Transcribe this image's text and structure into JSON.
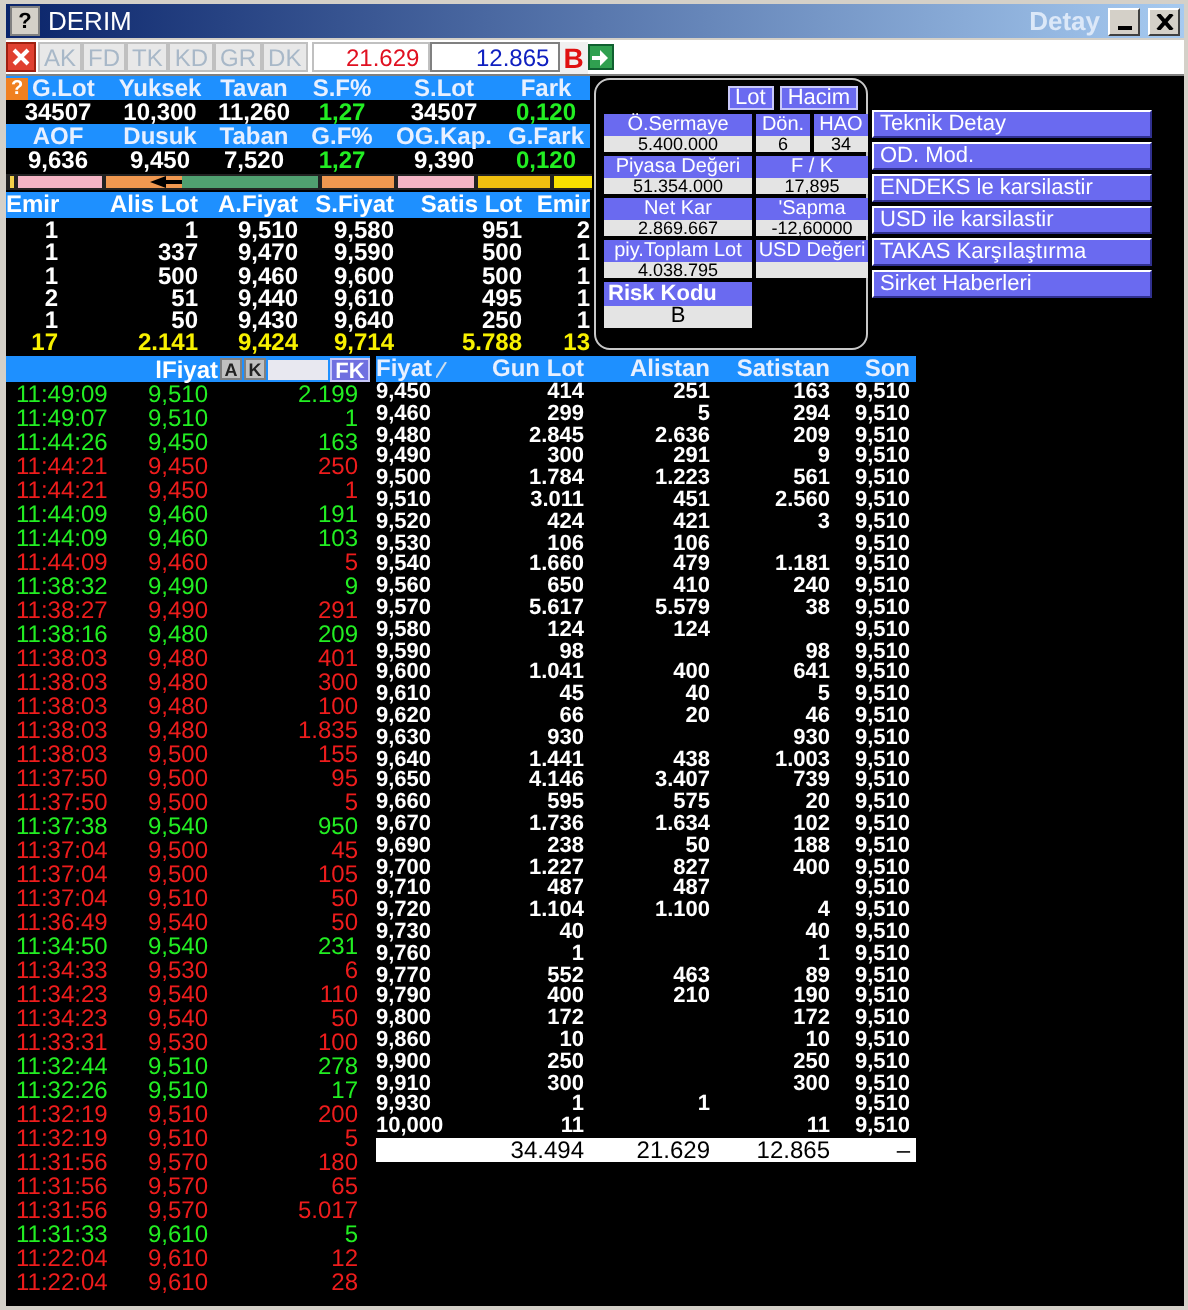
{
  "window": {
    "help": "?",
    "title": "DERIM",
    "subtitle": "Detay"
  },
  "summary_help": "?",
  "toolbar": {
    "tabs": [
      {
        "label": "AK",
        "disabled": true
      },
      {
        "label": "FD",
        "disabled": true
      },
      {
        "label": "TK",
        "disabled": true
      },
      {
        "label": "KD",
        "disabled": true
      },
      {
        "label": "GR",
        "disabled": true
      },
      {
        "label": "DK",
        "disabled": true
      }
    ],
    "bid_total": "21.629",
    "ask_total": "12.865",
    "mode": "B"
  },
  "summary": [
    {
      "headers": [
        "G.Lot",
        "Yuksek",
        "Tavan",
        "S.F%",
        "S.Lot",
        "Fark"
      ],
      "values": [
        "34507",
        "10,300",
        "11,260",
        "1,27",
        "34507",
        "0,120"
      ]
    },
    {
      "headers": [
        "AOF",
        "Dusuk",
        "Taban",
        "G.F%",
        "OG.Kap.",
        "G.Fark"
      ],
      "values": [
        "9,636",
        "9,450",
        "7,520",
        "1,27",
        "9,390",
        "0,120"
      ]
    }
  ],
  "depth": {
    "columns": [
      "Emir",
      "Alis Lot",
      "A.Fiyat",
      "S.Fiyat",
      "Satis Lot",
      "Emir"
    ],
    "rows": [
      [
        "1",
        "1",
        "9,510",
        "9,580",
        "951",
        "2"
      ],
      [
        "1",
        "337",
        "9,470",
        "9,590",
        "500",
        "1"
      ],
      [
        "1",
        "500",
        "9,460",
        "9,600",
        "500",
        "1"
      ],
      [
        "2",
        "51",
        "9,440",
        "9,610",
        "495",
        "1"
      ],
      [
        "1",
        "50",
        "9,430",
        "9,640",
        "250",
        "1"
      ]
    ],
    "totals": [
      "17",
      "2.141",
      "9,424",
      "9,714",
      "5.788",
      "13"
    ]
  },
  "info_panel": {
    "toggles": [
      "Lot",
      "Hacim"
    ],
    "fields": [
      {
        "label": "Ö.Sermaye",
        "value": "5.400.000"
      },
      {
        "label": "Dön.",
        "value": "6"
      },
      {
        "label": "HAO",
        "value": "34"
      },
      {
        "label": "Piyasa Değeri",
        "value": "51.354.000"
      },
      {
        "label": "F / K",
        "value": "17,895"
      },
      {
        "label": "Net Kar",
        "value": "2.869.667"
      },
      {
        "label": "'Sapma",
        "value": "-12,60000"
      },
      {
        "label": "piy.Toplam Lot",
        "value": "4.038.795"
      },
      {
        "label": "USD Değeri"
      }
    ],
    "risk": {
      "label": "Risk Kodu",
      "value": "B"
    }
  },
  "actions": [
    "Teknik Detay",
    "OD. Mod.",
    "ENDEKS le karsilastir",
    "USD ile karsilastir",
    "TAKAS Karşılaştırma",
    "Sirket Haberleri"
  ],
  "trades": {
    "price_label": "lFiyat",
    "buttons": [
      "A",
      "K"
    ],
    "filter_button": "FK",
    "rows": [
      {
        "time": "11:49:09",
        "price": "9,510",
        "lot": "2.199",
        "kind": "buy"
      },
      {
        "time": "11:49:07",
        "price": "9,510",
        "lot": "1",
        "kind": "buy"
      },
      {
        "time": "11:44:26",
        "price": "9,450",
        "lot": "163",
        "kind": "buy"
      },
      {
        "time": "11:44:21",
        "price": "9,450",
        "lot": "250",
        "kind": "sell"
      },
      {
        "time": "11:44:21",
        "price": "9,450",
        "lot": "1",
        "kind": "sell"
      },
      {
        "time": "11:44:09",
        "price": "9,460",
        "lot": "191",
        "kind": "buy"
      },
      {
        "time": "11:44:09",
        "price": "9,460",
        "lot": "103",
        "kind": "buy"
      },
      {
        "time": "11:44:09",
        "price": "9,460",
        "lot": "5",
        "kind": "sell"
      },
      {
        "time": "11:38:32",
        "price": "9,490",
        "lot": "9",
        "kind": "buy"
      },
      {
        "time": "11:38:27",
        "price": "9,490",
        "lot": "291",
        "kind": "sell"
      },
      {
        "time": "11:38:16",
        "price": "9,480",
        "lot": "209",
        "kind": "buy"
      },
      {
        "time": "11:38:03",
        "price": "9,480",
        "lot": "401",
        "kind": "sell"
      },
      {
        "time": "11:38:03",
        "price": "9,480",
        "lot": "300",
        "kind": "sell"
      },
      {
        "time": "11:38:03",
        "price": "9,480",
        "lot": "100",
        "kind": "sell"
      },
      {
        "time": "11:38:03",
        "price": "9,480",
        "lot": "1.835",
        "kind": "sell"
      },
      {
        "time": "11:38:03",
        "price": "9,500",
        "lot": "155",
        "kind": "sell"
      },
      {
        "time": "11:37:50",
        "price": "9,500",
        "lot": "95",
        "kind": "sell"
      },
      {
        "time": "11:37:50",
        "price": "9,500",
        "lot": "5",
        "kind": "sell"
      },
      {
        "time": "11:37:38",
        "price": "9,540",
        "lot": "950",
        "kind": "buy"
      },
      {
        "time": "11:37:04",
        "price": "9,500",
        "lot": "45",
        "kind": "sell"
      },
      {
        "time": "11:37:04",
        "price": "9,500",
        "lot": "105",
        "kind": "sell"
      },
      {
        "time": "11:37:04",
        "price": "9,510",
        "lot": "50",
        "kind": "sell"
      },
      {
        "time": "11:36:49",
        "price": "9,540",
        "lot": "50",
        "kind": "sell"
      },
      {
        "time": "11:34:50",
        "price": "9,540",
        "lot": "231",
        "kind": "buy"
      },
      {
        "time": "11:34:33",
        "price": "9,530",
        "lot": "6",
        "kind": "sell"
      },
      {
        "time": "11:34:23",
        "price": "9,540",
        "lot": "110",
        "kind": "sell"
      },
      {
        "time": "11:34:23",
        "price": "9,540",
        "lot": "50",
        "kind": "sell"
      },
      {
        "time": "11:33:31",
        "price": "9,530",
        "lot": "100",
        "kind": "sell"
      },
      {
        "time": "11:32:44",
        "price": "9,510",
        "lot": "278",
        "kind": "buy"
      },
      {
        "time": "11:32:26",
        "price": "9,510",
        "lot": "17",
        "kind": "buy"
      },
      {
        "time": "11:32:19",
        "price": "9,510",
        "lot": "200",
        "kind": "sell"
      },
      {
        "time": "11:32:19",
        "price": "9,510",
        "lot": "5",
        "kind": "sell"
      },
      {
        "time": "11:31:56",
        "price": "9,570",
        "lot": "180",
        "kind": "sell"
      },
      {
        "time": "11:31:56",
        "price": "9,570",
        "lot": "65",
        "kind": "sell"
      },
      {
        "time": "11:31:56",
        "price": "9,570",
        "lot": "5.017",
        "kind": "sell"
      },
      {
        "time": "11:31:33",
        "price": "9,610",
        "lot": "5",
        "kind": "buy"
      },
      {
        "time": "11:22:04",
        "price": "9,610",
        "lot": "12",
        "kind": "sell"
      },
      {
        "time": "11:22:04",
        "price": "9,610",
        "lot": "28",
        "kind": "sell"
      }
    ]
  },
  "price_table": {
    "columns": [
      "Fiyat",
      "Gun Lot",
      "Alistan",
      "Satistan",
      "Son"
    ],
    "rows": [
      [
        "9,450",
        "414",
        "251",
        "163",
        "9,510"
      ],
      [
        "9,460",
        "299",
        "5",
        "294",
        "9,510"
      ],
      [
        "9,480",
        "2.845",
        "2.636",
        "209",
        "9,510"
      ],
      [
        "9,490",
        "300",
        "291",
        "9",
        "9,510"
      ],
      [
        "9,500",
        "1.784",
        "1.223",
        "561",
        "9,510"
      ],
      [
        "9,510",
        "3.011",
        "451",
        "2.560",
        "9,510"
      ],
      [
        "9,520",
        "424",
        "421",
        "3",
        "9,510"
      ],
      [
        "9,530",
        "106",
        "106",
        "",
        "9,510"
      ],
      [
        "9,540",
        "1.660",
        "479",
        "1.181",
        "9,510"
      ],
      [
        "9,560",
        "650",
        "410",
        "240",
        "9,510"
      ],
      [
        "9,570",
        "5.617",
        "5.579",
        "38",
        "9,510"
      ],
      [
        "9,580",
        "124",
        "124",
        "",
        "9,510"
      ],
      [
        "9,590",
        "98",
        "",
        "98",
        "9,510"
      ],
      [
        "9,600",
        "1.041",
        "400",
        "641",
        "9,510"
      ],
      [
        "9,610",
        "45",
        "40",
        "5",
        "9,510"
      ],
      [
        "9,620",
        "66",
        "20",
        "46",
        "9,510"
      ],
      [
        "9,630",
        "930",
        "",
        "930",
        "9,510"
      ],
      [
        "9,640",
        "1.441",
        "438",
        "1.003",
        "9,510"
      ],
      [
        "9,650",
        "4.146",
        "3.407",
        "739",
        "9,510"
      ],
      [
        "9,660",
        "595",
        "575",
        "20",
        "9,510"
      ],
      [
        "9,670",
        "1.736",
        "1.634",
        "102",
        "9,510"
      ],
      [
        "9,690",
        "238",
        "50",
        "188",
        "9,510"
      ],
      [
        "9,700",
        "1.227",
        "827",
        "400",
        "9,510"
      ],
      [
        "9,710",
        "487",
        "487",
        "",
        "9,510"
      ],
      [
        "9,720",
        "1.104",
        "1.100",
        "4",
        "9,510"
      ],
      [
        "9,730",
        "40",
        "",
        "40",
        "9,510"
      ],
      [
        "9,760",
        "1",
        "",
        "1",
        "9,510"
      ],
      [
        "9,770",
        "552",
        "463",
        "89",
        "9,510"
      ],
      [
        "9,790",
        "400",
        "210",
        "190",
        "9,510"
      ],
      [
        "9,800",
        "172",
        "",
        "172",
        "9,510"
      ],
      [
        "9,860",
        "10",
        "",
        "10",
        "9,510"
      ],
      [
        "9,900",
        "250",
        "",
        "250",
        "9,510"
      ],
      [
        "9,910",
        "300",
        "",
        "300",
        "9,510"
      ],
      [
        "9,930",
        "1",
        "1",
        "",
        "9,510"
      ],
      [
        "10,000",
        "11",
        "",
        "11",
        "9,510"
      ]
    ],
    "totals": [
      "34.494",
      "21.629",
      "12.865",
      "–"
    ]
  }
}
